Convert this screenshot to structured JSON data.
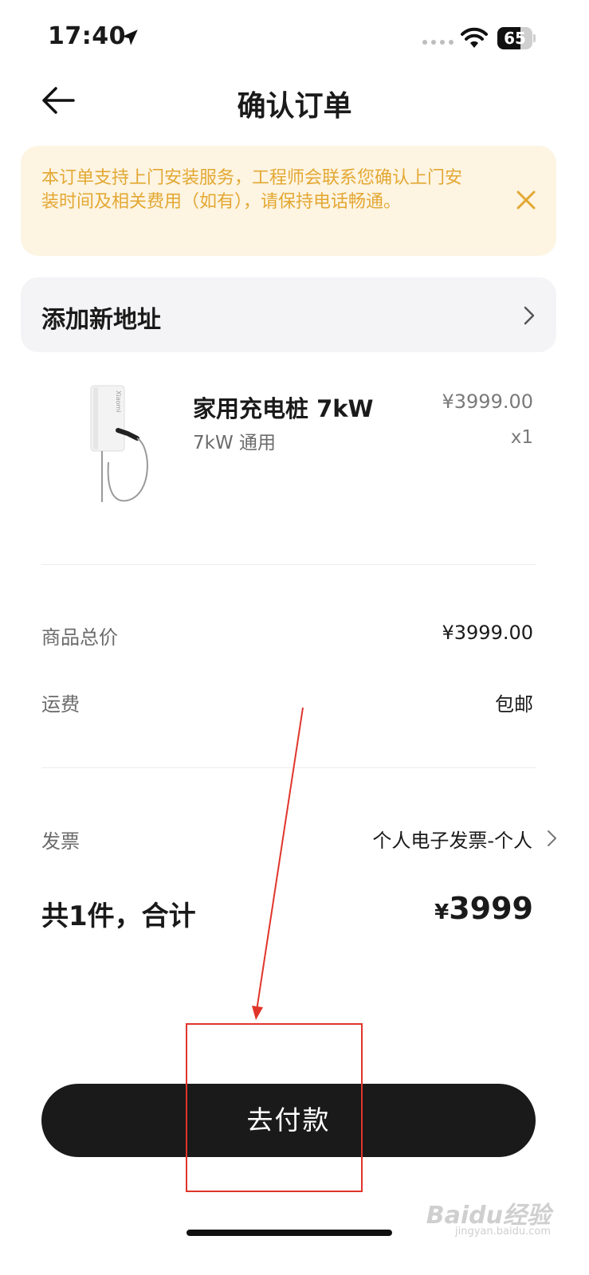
{
  "status_bar": {
    "time": "17:40",
    "battery": "65",
    "battery_level": 0.65
  },
  "header": {
    "title": "确认订单"
  },
  "notice": {
    "text": "本订单支持上门安装服务，工程师会联系您确认上门安装时间及相关费用（如有），请保持电话畅通。"
  },
  "address": {
    "label": "添加新地址"
  },
  "product": {
    "name": "家用充电桩 7kW",
    "spec": "7kW 通用",
    "price": "¥3999.00",
    "quantity": "x1",
    "brand_mark": "Xiaomi"
  },
  "summary": {
    "goods_total_label": "商品总价",
    "goods_total_value": "¥3999.00",
    "shipping_label": "运费",
    "shipping_value": "包邮",
    "invoice_label": "发票",
    "invoice_value": "个人电子发票-个人"
  },
  "total": {
    "label": "共1件，合计",
    "currency": "¥",
    "amount": "3999"
  },
  "pay_button": {
    "label": "去付款"
  },
  "watermark": {
    "brand": "Baidu经验",
    "url": "jingyan.baidu.com"
  },
  "colors": {
    "notice_bg": "#fdf4e2",
    "notice_text": "#e3a833",
    "button_bg": "#1a1a1a",
    "annotation": "#e0352b"
  }
}
